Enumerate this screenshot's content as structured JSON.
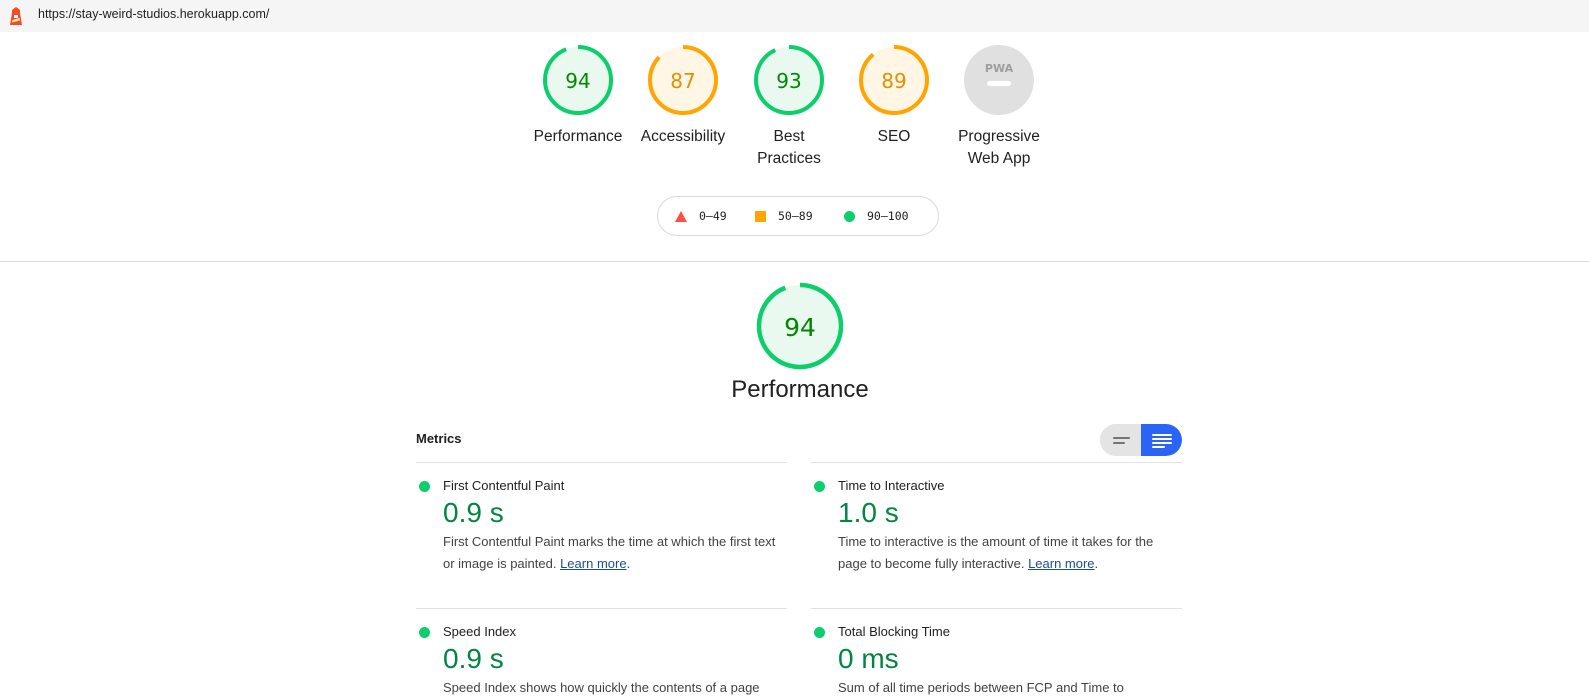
{
  "browser": {
    "url": "https://stay-weird-studios.herokuapp.com/"
  },
  "gauges": [
    {
      "label_line1": "Performance",
      "label_line2": "",
      "score": "94",
      "status": "pass"
    },
    {
      "label_line1": "Accessibility",
      "label_line2": "",
      "score": "87",
      "status": "average"
    },
    {
      "label_line1": "Best",
      "label_line2": "Practices",
      "score": "93",
      "status": "pass"
    },
    {
      "label_line1": "SEO",
      "label_line2": "",
      "score": "89",
      "status": "average"
    },
    {
      "label_line1": "Progressive",
      "label_line2": "Web App",
      "score": "PWA",
      "status": "na"
    }
  ],
  "legend": {
    "fail": "0–49",
    "average": "50–89",
    "pass": "90–100"
  },
  "performance": {
    "score": "94",
    "title": "Performance"
  },
  "metrics": {
    "title": "Metrics",
    "items": [
      {
        "title": "First Contentful Paint",
        "value": "0.9 s",
        "desc_line1": "First Contentful Paint marks the time at which the first text",
        "desc_line2": "or image is painted. ",
        "link": "Learn more",
        "after_link": "."
      },
      {
        "title": "Time to Interactive",
        "value": "1.0 s",
        "desc_line1": "Time to interactive is the amount of time it takes for the",
        "desc_line2": "page to become fully interactive. ",
        "link": "Learn more",
        "after_link": "."
      },
      {
        "title": "Speed Index",
        "value": "0.9 s",
        "desc_line1": "Speed Index shows how quickly the contents of a page",
        "desc_line2": "",
        "link": "",
        "after_link": ""
      },
      {
        "title": "Total Blocking Time",
        "value": "0 ms",
        "desc_line1": "Sum of all time periods between FCP and Time to",
        "desc_line2": "",
        "link": "",
        "after_link": ""
      }
    ]
  },
  "colors": {
    "pass": "#0cce6b",
    "pass_text": "#008800",
    "average": "#ffa400",
    "average_text": "#c33300",
    "fail": "#ff4e42",
    "na": "#e0e0e0",
    "toggle_active": "#2a64f6"
  },
  "icons": {
    "lighthouse": "lighthouse-icon",
    "toggle_compact": "compact-view-icon",
    "toggle_expanded": "expanded-view-icon"
  }
}
